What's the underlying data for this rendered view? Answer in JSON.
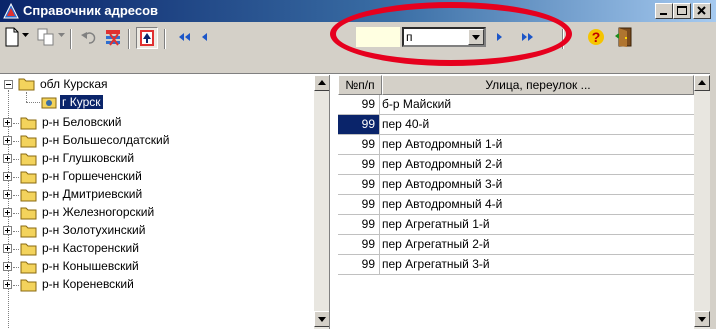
{
  "window": {
    "title": "Справочник адресов",
    "buttons": [
      "minimize",
      "maximize",
      "close"
    ]
  },
  "toolbar": {
    "filter_value": "",
    "combo_value": "п",
    "icons": [
      "new-document-icon",
      "dropdown-arrow-icon",
      "copy-icon",
      "undo-icon",
      "delete-record-icon",
      "sort-up-icon",
      "first-icon",
      "prev-icon",
      "next-icon",
      "last-icon",
      "help-icon",
      "exit-door-icon"
    ]
  },
  "highlight_color": "#e6001e",
  "tree": {
    "root": "обл Курская",
    "selected": "г Курск",
    "items": [
      "р-н Беловский",
      "р-н Большесолдатский",
      "р-н Глушковский",
      "р-н Горшеченский",
      "р-н Дмитриевский",
      "р-н Железногорский",
      "р-н Золотухинский",
      "р-н Касторенский",
      "р-н Конышевский",
      "р-н Кореневский"
    ]
  },
  "grid": {
    "columns": [
      "№п/п",
      "Улица, переулок ..."
    ],
    "rows": [
      {
        "num": "99",
        "name": "б-р Майский"
      },
      {
        "num": "99",
        "name": "пер 40-й"
      },
      {
        "num": "99",
        "name": "пер Автодромный 1-й"
      },
      {
        "num": "99",
        "name": "пер Автодромный 2-й"
      },
      {
        "num": "99",
        "name": "пер Автодромный 3-й"
      },
      {
        "num": "99",
        "name": "пер Автодромный 4-й"
      },
      {
        "num": "99",
        "name": "пер Агрегатный 1-й"
      },
      {
        "num": "99",
        "name": "пер Агрегатный 2-й"
      },
      {
        "num": "99",
        "name": "пер Агрегатный 3-й"
      }
    ]
  }
}
